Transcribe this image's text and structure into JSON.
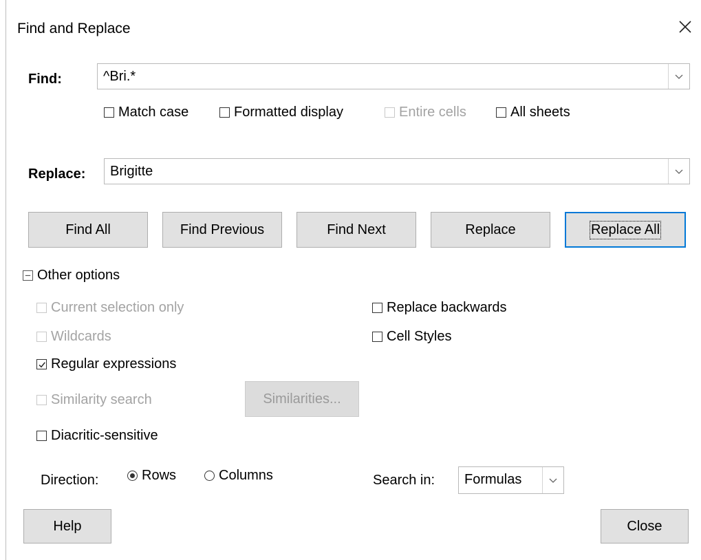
{
  "window": {
    "title": "Find and Replace"
  },
  "find": {
    "label": "Find:",
    "value": "^Bri.*",
    "options": {
      "match_case": "Match case",
      "formatted_display": "Formatted display",
      "entire_cells": "Entire cells",
      "all_sheets": "All sheets"
    }
  },
  "replace": {
    "label": "Replace:",
    "value": "Brigitte"
  },
  "buttons": {
    "find_all": "Find All",
    "find_previous": "Find Previous",
    "find_next": "Find Next",
    "replace": "Replace",
    "replace_all": "Replace All",
    "similarities": "Similarities...",
    "help": "Help",
    "close": "Close"
  },
  "other_options": {
    "header": "Other options",
    "current_selection_only": "Current selection only",
    "wildcards": "Wildcards",
    "regular_expressions": "Regular expressions",
    "similarity_search": "Similarity search",
    "diacritic_sensitive": "Diacritic-sensitive",
    "replace_backwards": "Replace backwards",
    "cell_styles": "Cell Styles"
  },
  "direction": {
    "label": "Direction:",
    "rows": "Rows",
    "columns": "Columns",
    "selected": "Rows"
  },
  "search_in": {
    "label": "Search in:",
    "value": "Formulas"
  },
  "state": {
    "match_case": false,
    "formatted_display": false,
    "entire_cells": false,
    "all_sheets": false,
    "current_selection_only": false,
    "wildcards": false,
    "regular_expressions": true,
    "similarity_search": false,
    "diacritic_sensitive": false,
    "replace_backwards": false,
    "cell_styles": false
  },
  "colors": {
    "default_button_border": "#0078d7",
    "disabled_text": "#a3a3a3",
    "button_face": "#e1e1e1"
  }
}
